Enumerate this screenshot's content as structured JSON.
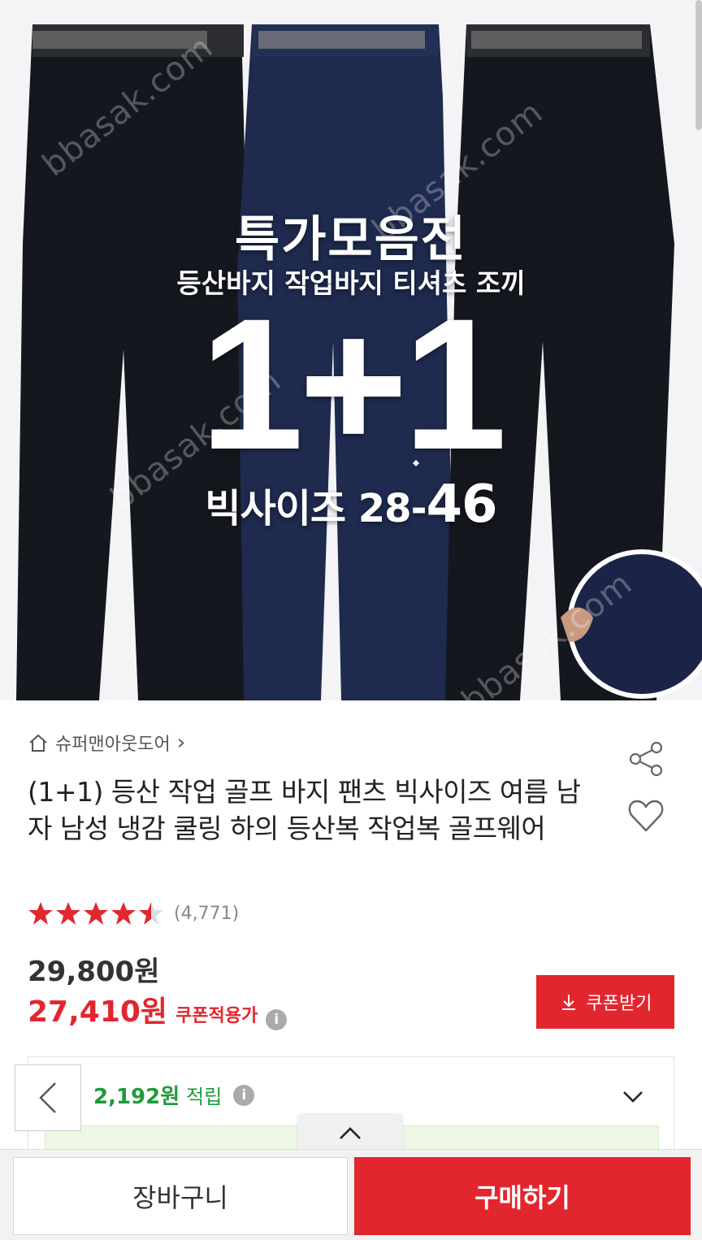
{
  "hero": {
    "title": "특가모음전",
    "subtitle": "등산바지 작업바지 티셔츠 조끼",
    "promo": "1+1",
    "size_prefix": "빅사이즈 28-",
    "size_max": "46",
    "watermark": "bbasak.com"
  },
  "store": {
    "name": "슈퍼맨아웃도어",
    "chevron": "›"
  },
  "product": {
    "title": "(1+1) 등산 작업 골프 바지 팬츠 빅사이즈 여름 남자 남성 냉감 쿨링 하의 등산복 작업복 골프웨어"
  },
  "rating": {
    "score": 4.5,
    "max": 5,
    "review_count": "(4,771)"
  },
  "price": {
    "original": "29,800원",
    "sale": "27,410원",
    "sale_label": "쿠폰적용가",
    "info": "i"
  },
  "coupon": {
    "label": "쿠폰받기"
  },
  "points": {
    "amount": "2,192원",
    "label": "적립",
    "info": "i"
  },
  "bottom": {
    "cart_label": "장바구니",
    "buy_label": "구매하기"
  },
  "colors": {
    "accent": "#e2262e",
    "points": "#1e9b3a",
    "pants_black": "#15171f",
    "pants_navy": "#1e2a4e",
    "star": "#e2262e"
  },
  "icons": {
    "store": "home-icon",
    "share": "share-icon",
    "wishlist": "heart-icon",
    "coupon": "download-icon",
    "points_toggle": "chevron-down-icon",
    "back": "chevron-left-icon",
    "collapse": "chevron-up-icon"
  }
}
